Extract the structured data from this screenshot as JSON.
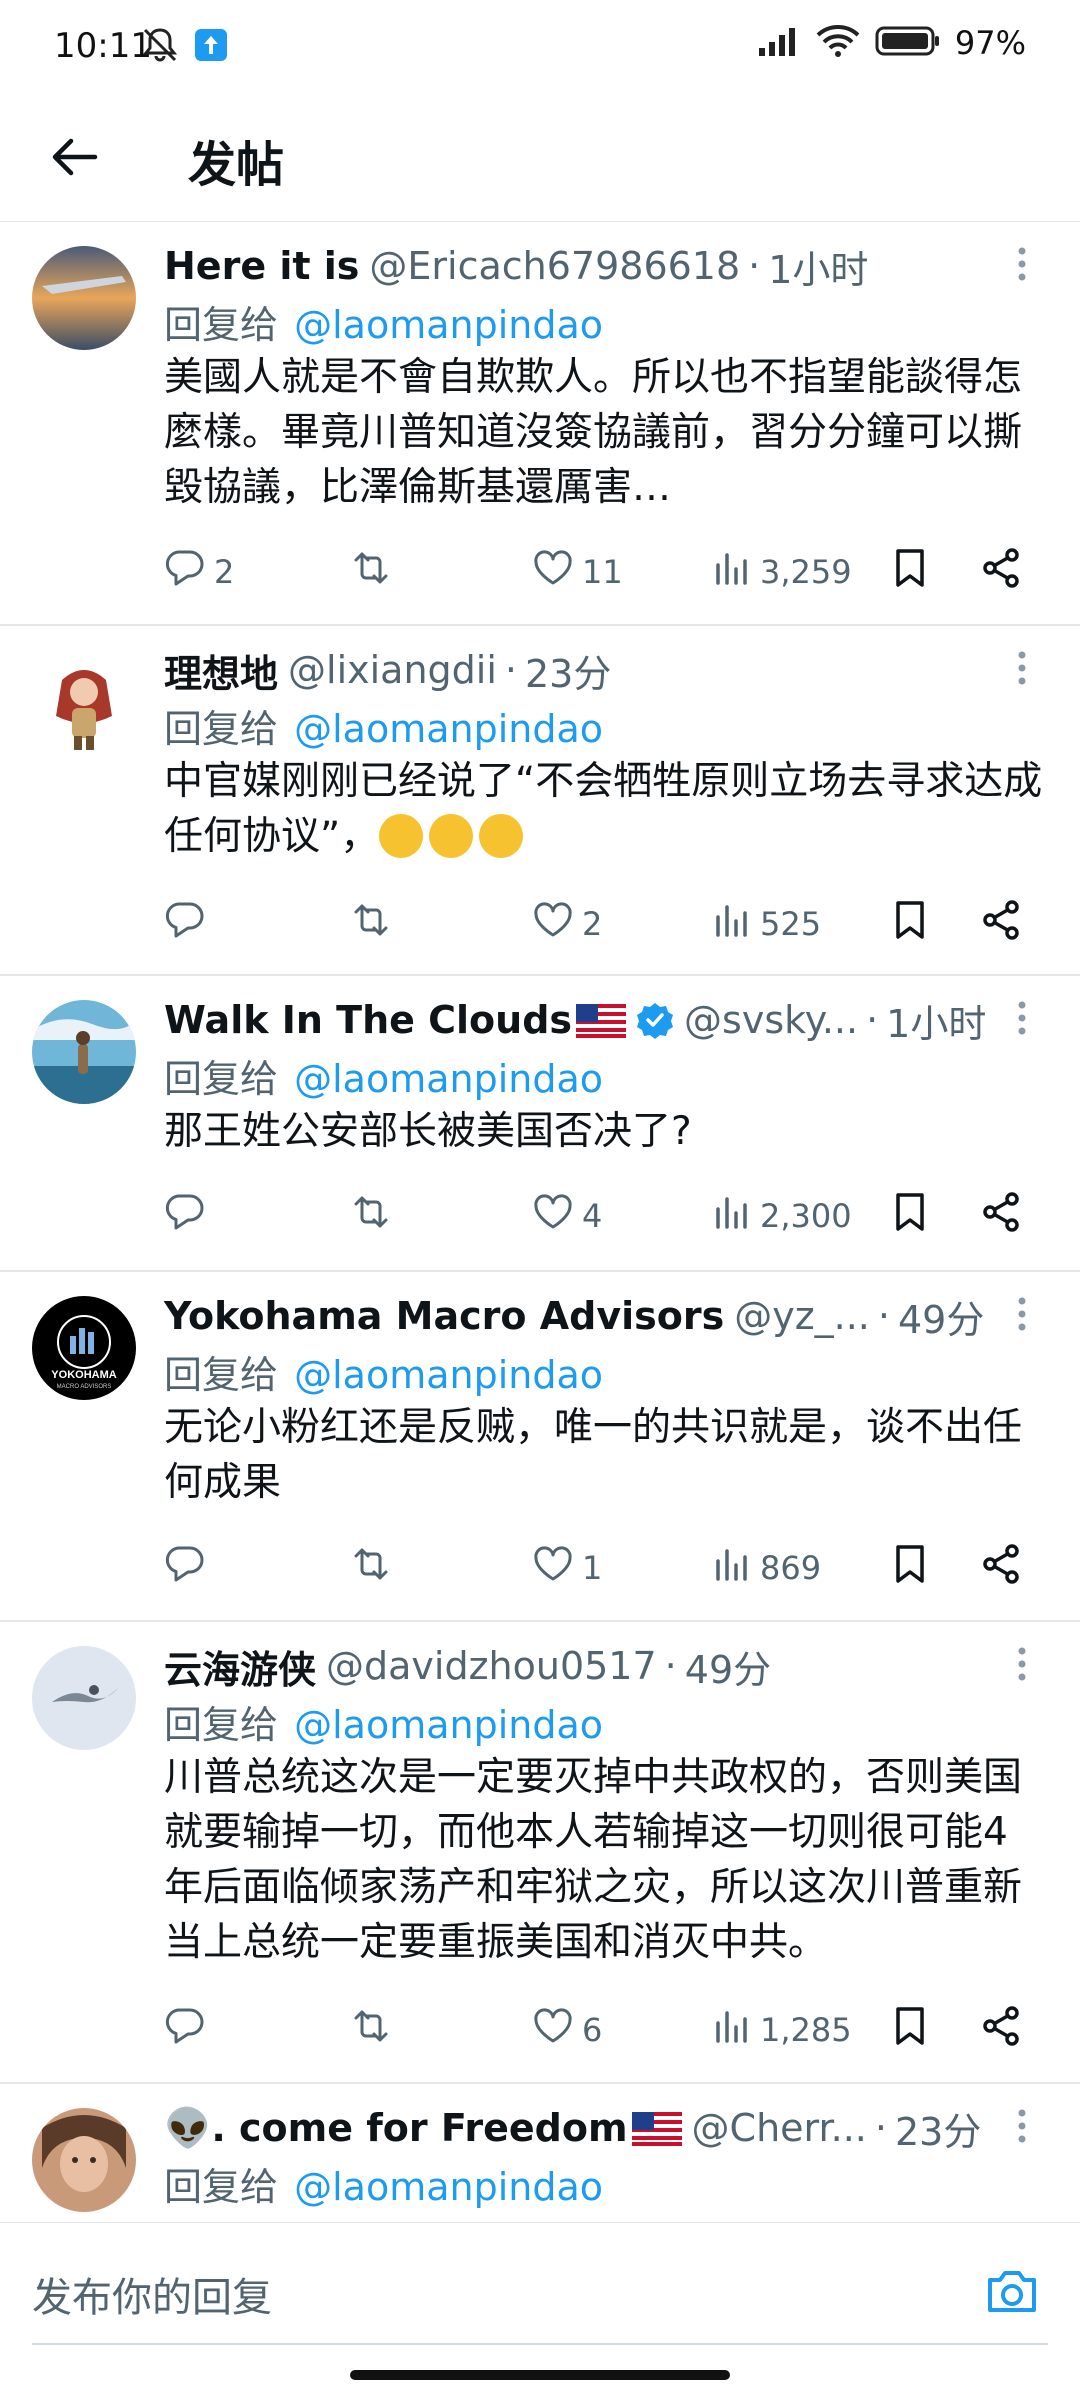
{
  "status_bar": {
    "time": "10:11",
    "battery": "97%"
  },
  "header": {
    "title": "发帖"
  },
  "replies": [
    {
      "name": "Here it is",
      "handle": "@Ericach67986618",
      "time": "1小时",
      "replying_prefix": "回复给",
      "replying_to": "@laomanpindao",
      "text": "美國人就是不會自欺欺人。所以也不指望能談得怎麼樣。畢竟川普知道沒簽協議前，習分分鐘可以撕毀協議，比澤倫斯基還厲害…",
      "stats": {
        "replies": "2",
        "reposts": "",
        "likes": "11",
        "views": "3,259"
      },
      "avatar_colors": [
        "#e8a65a",
        "#3c4c66"
      ]
    },
    {
      "name": "理想地",
      "handle": "@lixiangdii",
      "time": "23分",
      "replying_prefix": "回复给",
      "replying_to": "@laomanpindao",
      "text": "中官媒刚刚已经说了“不会牺牲原则立场去寻求达成任何协议”，",
      "emoji_count": 3,
      "stats": {
        "replies": "",
        "reposts": "",
        "likes": "2",
        "views": "525"
      },
      "avatar_colors": [
        "#ffffff",
        "#a8382a"
      ]
    },
    {
      "name": "Walk In The Clouds",
      "handle": "@svsky...",
      "time": "1小时",
      "verified": true,
      "flag": "us-flag",
      "replying_prefix": "回复给",
      "replying_to": "@laomanpindao",
      "text": "那王姓公安部长被美国否决了?",
      "stats": {
        "replies": "",
        "reposts": "",
        "likes": "4",
        "views": "2,300"
      },
      "avatar_colors": [
        "#6fb6d8",
        "#2d6f91"
      ]
    },
    {
      "name": "Yokohama Macro Advisors",
      "handle": "@yz_...",
      "time": "49分",
      "replying_prefix": "回复给",
      "replying_to": "@laomanpindao",
      "text": "无论小粉红还是反贼，唯一的共识就是，谈不出任何成果",
      "avatar_text": "YOKOHAMA",
      "avatar_subtext": "MACRO ADVISORS",
      "stats": {
        "replies": "",
        "reposts": "",
        "likes": "1",
        "views": "869"
      },
      "avatar_colors": [
        "#000000",
        "#ffffff"
      ]
    },
    {
      "name": "云海游侠",
      "handle": "@davidzhou0517",
      "time": "49分",
      "replying_prefix": "回复给",
      "replying_to": "@laomanpindao",
      "text": "川普总统这次是一定要灭掉中共政权的，否则美国就要输掉一切，而他本人若输掉这一切则很可能4年后面临倾家荡产和牢狱之灾，所以这次川普重新当上总统一定要重振美国和消灭中共。",
      "stats": {
        "replies": "",
        "reposts": "",
        "likes": "6",
        "views": "1,285"
      },
      "avatar_colors": [
        "#dfe6ef",
        "#7b8795"
      ]
    },
    {
      "name": "👽. come for Freedom",
      "handle": "@Cherr...",
      "time": "23分",
      "flag": "us-flag",
      "replying_prefix": "回复给",
      "replying_to": "@laomanpindao",
      "text": "",
      "stats": {
        "replies": "",
        "reposts": "",
        "likes": "",
        "views": ""
      },
      "avatar_colors": [
        "#c99a7a",
        "#5a3b2a"
      ]
    }
  ],
  "compose": {
    "placeholder": "发布你的回复"
  },
  "icons": {
    "back": "arrow-left-icon",
    "more": "more-vertical-icon",
    "reply": "reply-icon",
    "repost": "repost-icon",
    "like": "heart-icon",
    "views": "views-icon",
    "bookmark": "bookmark-icon",
    "share": "share-icon",
    "camera": "camera-icon"
  },
  "colors": {
    "accent": "#1d9bf0",
    "muted": "#536471",
    "divider": "#e4e7ea"
  }
}
